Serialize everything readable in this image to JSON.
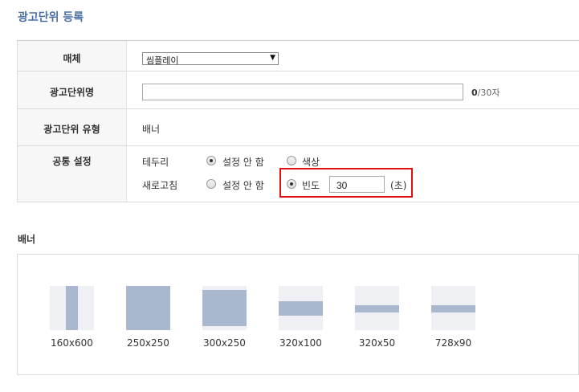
{
  "page": {
    "title": "광고단위 등록"
  },
  "form": {
    "media": {
      "label": "매체",
      "selected": "씸플레이"
    },
    "ad_unit_name": {
      "label": "광고단위명",
      "value": "",
      "count": "0",
      "max": "/30자"
    },
    "ad_unit_type": {
      "label": "광고단위 유형",
      "value": "배너"
    },
    "common": {
      "label": "공통 설정",
      "border": {
        "label": "테두리",
        "options": [
          {
            "label": "설정 안 함",
            "checked": true
          },
          {
            "label": "색상",
            "checked": false
          }
        ]
      },
      "refresh": {
        "label": "새로고침",
        "options": [
          {
            "label": "설정 안 함",
            "checked": false
          },
          {
            "label": "빈도",
            "checked": true
          }
        ],
        "frequency_value": "30",
        "unit": "(초)"
      }
    }
  },
  "banner": {
    "title": "배너",
    "sizes": [
      {
        "label": "160x600",
        "ratio": "160:600"
      },
      {
        "label": "250x250",
        "ratio": "250:250"
      },
      {
        "label": "300x250",
        "ratio": "300:250"
      },
      {
        "label": "320x100",
        "ratio": "320:100"
      },
      {
        "label": "320x50",
        "ratio": "320:50"
      },
      {
        "label": "728x90",
        "ratio": "728:90"
      }
    ]
  },
  "colors": {
    "title_blue": "#4a6fa5",
    "highlight_red": "#e01010",
    "thumb_fill": "#a9b8cf"
  }
}
